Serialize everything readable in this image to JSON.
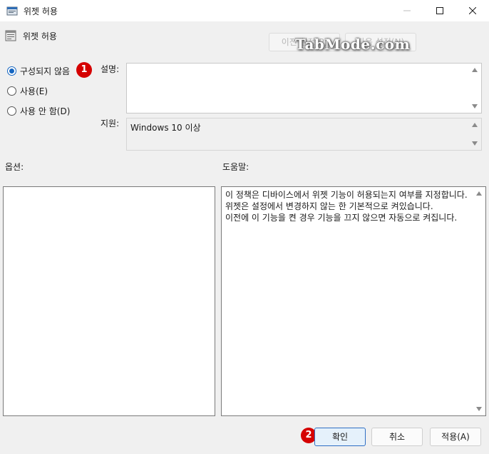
{
  "window": {
    "title": "위젯 허용"
  },
  "header": {
    "title": "위젯 허용",
    "prev_label": "이전 설정(P)",
    "next_label": "다음 설정(N)"
  },
  "watermark": "TabMode.com",
  "radios": [
    {
      "label": "구성되지 않음",
      "checked": true
    },
    {
      "label": "사용(E)",
      "checked": false
    },
    {
      "label": "사용 안 함(D)",
      "checked": false
    }
  ],
  "badges": [
    "1",
    "2"
  ],
  "labels": {
    "description": "설명:",
    "supported": "지원:",
    "options": "옵션:",
    "help": "도움말:"
  },
  "supported_value": "Windows 10 이상",
  "help_text": "이 정책은 디바이스에서 위젯 기능이 허용되는지 여부를 지정합니다.\n위젯은 설정에서 변경하지 않는 한 기본적으로 켜있습니다.\n이전에 이 기능을 켠 경우 기능을 끄지 않으면 자동으로 켜집니다.",
  "footer": {
    "ok_label": "확인",
    "cancel_label": "취소",
    "apply_label": "적용(A)"
  }
}
